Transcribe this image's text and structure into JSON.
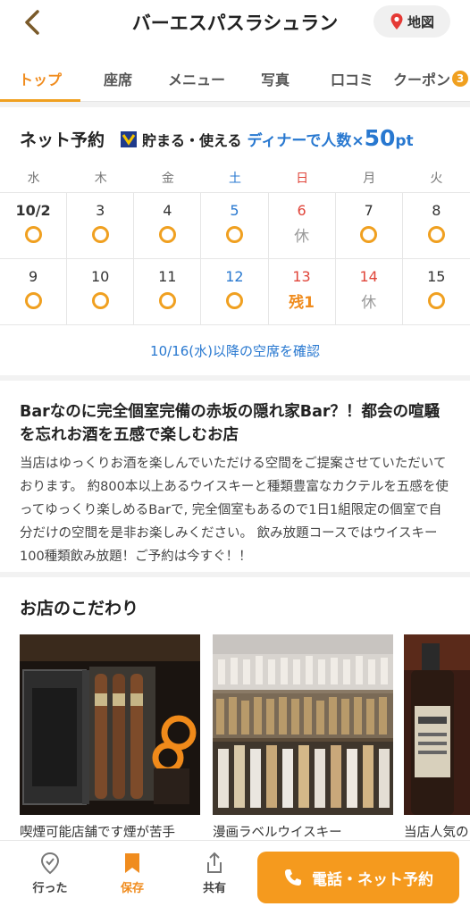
{
  "header": {
    "title": "バーエスパスラシュラン",
    "map_label": "地図"
  },
  "tabs": [
    {
      "label": "トップ"
    },
    {
      "label": "座席"
    },
    {
      "label": "メニュー"
    },
    {
      "label": "写真"
    },
    {
      "label": "口コミ"
    },
    {
      "label": "クーポン",
      "badge": "3"
    }
  ],
  "reservation": {
    "title": "ネット予約",
    "point_label": "貯まる・使える",
    "dinner_label": "ディナーで人数×",
    "points": "50",
    "pt_unit": "pt",
    "weekdays": [
      "水",
      "木",
      "金",
      "土",
      "日",
      "月",
      "火"
    ],
    "week1": [
      {
        "day": "10/2",
        "status": "○"
      },
      {
        "day": "3",
        "status": "○"
      },
      {
        "day": "4",
        "status": "○"
      },
      {
        "day": "5",
        "status": "○"
      },
      {
        "day": "6",
        "status": "休"
      },
      {
        "day": "7",
        "status": "○"
      },
      {
        "day": "8",
        "status": "○"
      }
    ],
    "week2": [
      {
        "day": "9",
        "status": "○"
      },
      {
        "day": "10",
        "status": "○"
      },
      {
        "day": "11",
        "status": "○"
      },
      {
        "day": "12",
        "status": "○"
      },
      {
        "day": "13",
        "status": "残1"
      },
      {
        "day": "14",
        "status": "休"
      },
      {
        "day": "15",
        "status": "○"
      }
    ],
    "more_link": "10/16(水)以降の空席を確認"
  },
  "description": {
    "title": "Barなのに完全個室完備の赤坂の隠れ家Bar？！都会の喧騒を忘れお酒を五感で楽しむお店",
    "body": "当店はゆっくりお酒を楽しんでいただける空間をご提案させていただいております。 約800本以上あるウイスキーと種類豊富なカクテルを五感を使ってゆっくり楽しめるBarで, 完全個室もあるので1日1組限定の個室で自分だけの空間を是非お楽しみください。 飲み放題コースではウイスキー100種類飲み放題！ご予約は今すぐ！！"
  },
  "kodawari": {
    "title": "お店のこだわり",
    "items": [
      {
        "caption": "喫煙可能店舗です煙が苦手"
      },
      {
        "caption": "漫画ラベルウイスキー"
      },
      {
        "caption": "当店人気の"
      }
    ]
  },
  "bottom_bar": {
    "went_label": "行った",
    "save_label": "保存",
    "share_label": "共有",
    "call_label": "電話・ネット予約"
  },
  "colors": {
    "accent": "#f08c1e",
    "link_blue": "#2878d0",
    "sunday_red": "#e0453a"
  }
}
